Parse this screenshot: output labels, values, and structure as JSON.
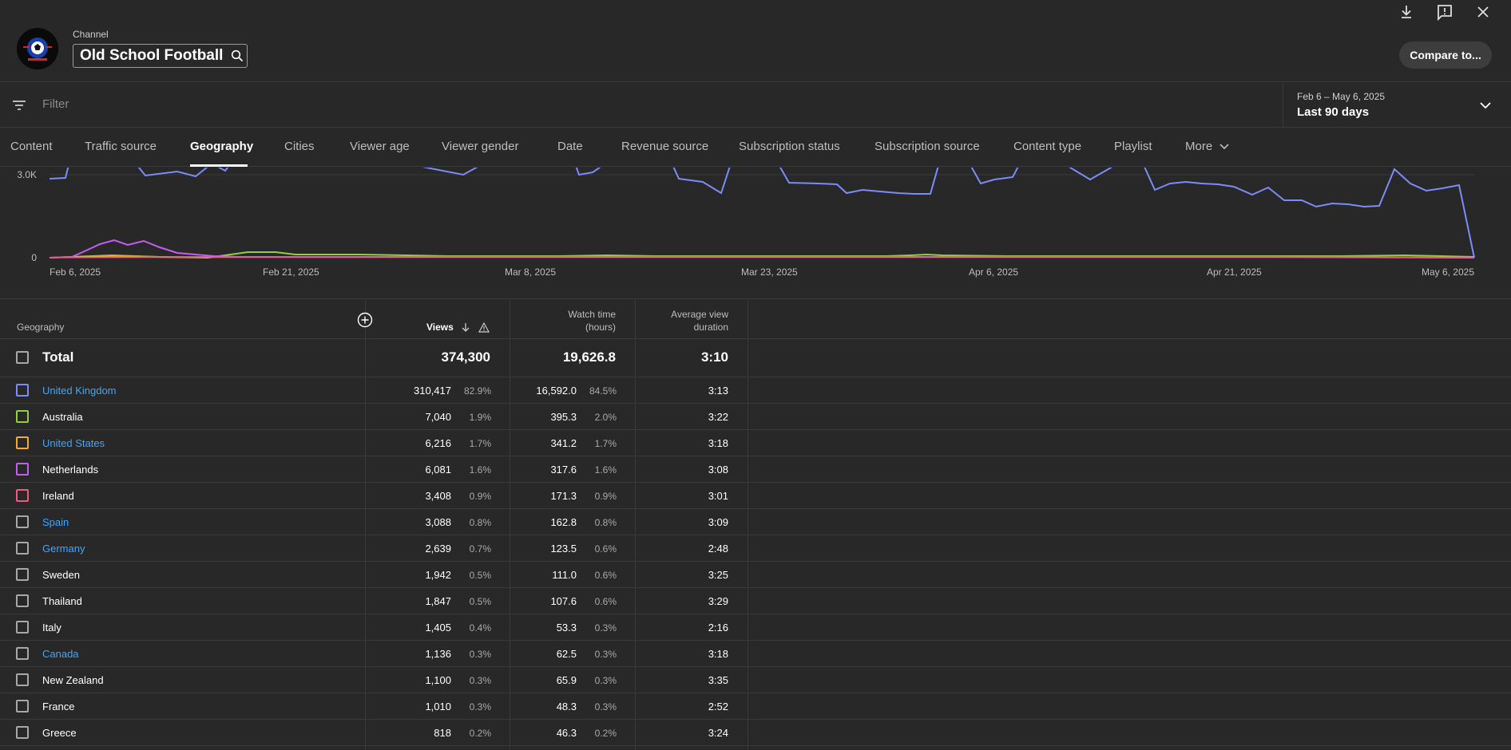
{
  "header": {
    "channel_label": "Channel",
    "channel_name": "Old School Football",
    "compare_label": "Compare to..."
  },
  "filter": {
    "placeholder": "Filter"
  },
  "date": {
    "range": "Feb 6 – May 6, 2025",
    "label": "Last 90 days"
  },
  "tabs": [
    "Content",
    "Traffic source",
    "Geography",
    "Cities",
    "Viewer age",
    "Viewer gender",
    "Date",
    "Revenue source",
    "Subscription status",
    "Subscription source",
    "Content type",
    "Playlist",
    "More"
  ],
  "active_tab": "Geography",
  "chart_data": {
    "type": "line",
    "x": [
      "Feb 6, 2025",
      "Feb 21, 2025",
      "Mar 8, 2025",
      "Mar 23, 2025",
      "Apr 6, 2025",
      "Apr 21, 2025",
      "May 6, 2025"
    ],
    "y_ticks": [
      "3.0K",
      "0"
    ],
    "series_colors": {
      "United Kingdom": "#7b8cf7",
      "Australia": "#8fd13f",
      "United States": "#f4a836",
      "Netherlands": "#c45ef2",
      "Ireland": "#f05a7a"
    }
  },
  "table": {
    "headers": {
      "geography": "Geography",
      "views": "Views",
      "watch_time": [
        "Watch time",
        "(hours)"
      ],
      "avg_duration": [
        "Average view",
        "duration"
      ]
    },
    "total": {
      "label": "Total",
      "views": "374,300",
      "watch": "19,626.8",
      "avg": "3:10"
    },
    "rows": [
      {
        "name": "United Kingdom",
        "link": true,
        "color": "#7b8cf7",
        "views": "310,417",
        "views_pct": "82.9%",
        "watch": "16,592.0",
        "watch_pct": "84.5%",
        "avg": "3:13"
      },
      {
        "name": "Australia",
        "link": false,
        "color": "#8fd13f",
        "views": "7,040",
        "views_pct": "1.9%",
        "watch": "395.3",
        "watch_pct": "2.0%",
        "avg": "3:22"
      },
      {
        "name": "United States",
        "link": true,
        "color": "#f4a836",
        "views": "6,216",
        "views_pct": "1.7%",
        "watch": "341.2",
        "watch_pct": "1.7%",
        "avg": "3:18"
      },
      {
        "name": "Netherlands",
        "link": false,
        "color": "#c45ef2",
        "views": "6,081",
        "views_pct": "1.6%",
        "watch": "317.6",
        "watch_pct": "1.6%",
        "avg": "3:08"
      },
      {
        "name": "Ireland",
        "link": false,
        "color": "#f05a7a",
        "views": "3,408",
        "views_pct": "0.9%",
        "watch": "171.3",
        "watch_pct": "0.9%",
        "avg": "3:01"
      },
      {
        "name": "Spain",
        "link": true,
        "color": "#a8a8a8",
        "views": "3,088",
        "views_pct": "0.8%",
        "watch": "162.8",
        "watch_pct": "0.8%",
        "avg": "3:09"
      },
      {
        "name": "Germany",
        "link": true,
        "color": "#a8a8a8",
        "views": "2,639",
        "views_pct": "0.7%",
        "watch": "123.5",
        "watch_pct": "0.6%",
        "avg": "2:48"
      },
      {
        "name": "Sweden",
        "link": false,
        "color": "#a8a8a8",
        "views": "1,942",
        "views_pct": "0.5%",
        "watch": "111.0",
        "watch_pct": "0.6%",
        "avg": "3:25"
      },
      {
        "name": "Thailand",
        "link": false,
        "color": "#a8a8a8",
        "views": "1,847",
        "views_pct": "0.5%",
        "watch": "107.6",
        "watch_pct": "0.6%",
        "avg": "3:29"
      },
      {
        "name": "Italy",
        "link": false,
        "color": "#a8a8a8",
        "views": "1,405",
        "views_pct": "0.4%",
        "watch": "53.3",
        "watch_pct": "0.3%",
        "avg": "2:16"
      },
      {
        "name": "Canada",
        "link": true,
        "color": "#a8a8a8",
        "views": "1,136",
        "views_pct": "0.3%",
        "watch": "62.5",
        "watch_pct": "0.3%",
        "avg": "3:18"
      },
      {
        "name": "New Zealand",
        "link": false,
        "color": "#a8a8a8",
        "views": "1,100",
        "views_pct": "0.3%",
        "watch": "65.9",
        "watch_pct": "0.3%",
        "avg": "3:35"
      },
      {
        "name": "France",
        "link": false,
        "color": "#a8a8a8",
        "views": "1,010",
        "views_pct": "0.3%",
        "watch": "48.3",
        "watch_pct": "0.3%",
        "avg": "2:52"
      },
      {
        "name": "Greece",
        "link": false,
        "color": "#a8a8a8",
        "views": "818",
        "views_pct": "0.2%",
        "watch": "46.3",
        "watch_pct": "0.2%",
        "avg": "3:24"
      }
    ]
  }
}
